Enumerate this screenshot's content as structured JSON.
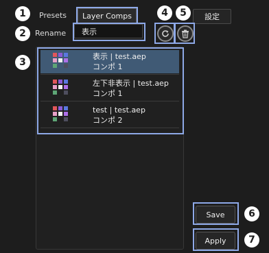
{
  "header": {
    "presets_label": "Presets",
    "active_tab_label": "Layer Comps",
    "rename_label": "Rename",
    "rename_value": "表示",
    "settings_label": "設定"
  },
  "icons": {
    "refresh": "refresh-icon",
    "trash": "trash-icon"
  },
  "callouts": [
    "1",
    "2",
    "3",
    "4",
    "5",
    "6",
    "7"
  ],
  "list": {
    "items": [
      {
        "title": "表示 | test.aep",
        "subtitle": "コンポ 1",
        "selected": true
      },
      {
        "title": "左下非表示 | test.aep",
        "subtitle": "コンポ 1",
        "selected": false
      },
      {
        "title": "test | test.aep",
        "subtitle": "コンポ 2",
        "selected": false
      }
    ]
  },
  "buttons": {
    "save_label": "Save",
    "apply_label": "Apply"
  },
  "colors": {
    "highlight": "#8ea9e8",
    "selected_row": "#405a75",
    "grid_palette": [
      "#e0565a",
      "#8b5bd6",
      "#5a78df",
      "#e8a0c8",
      "#f1f1f1",
      "#ad70e8",
      "#5ea676",
      "#4e4e5e"
    ]
  }
}
